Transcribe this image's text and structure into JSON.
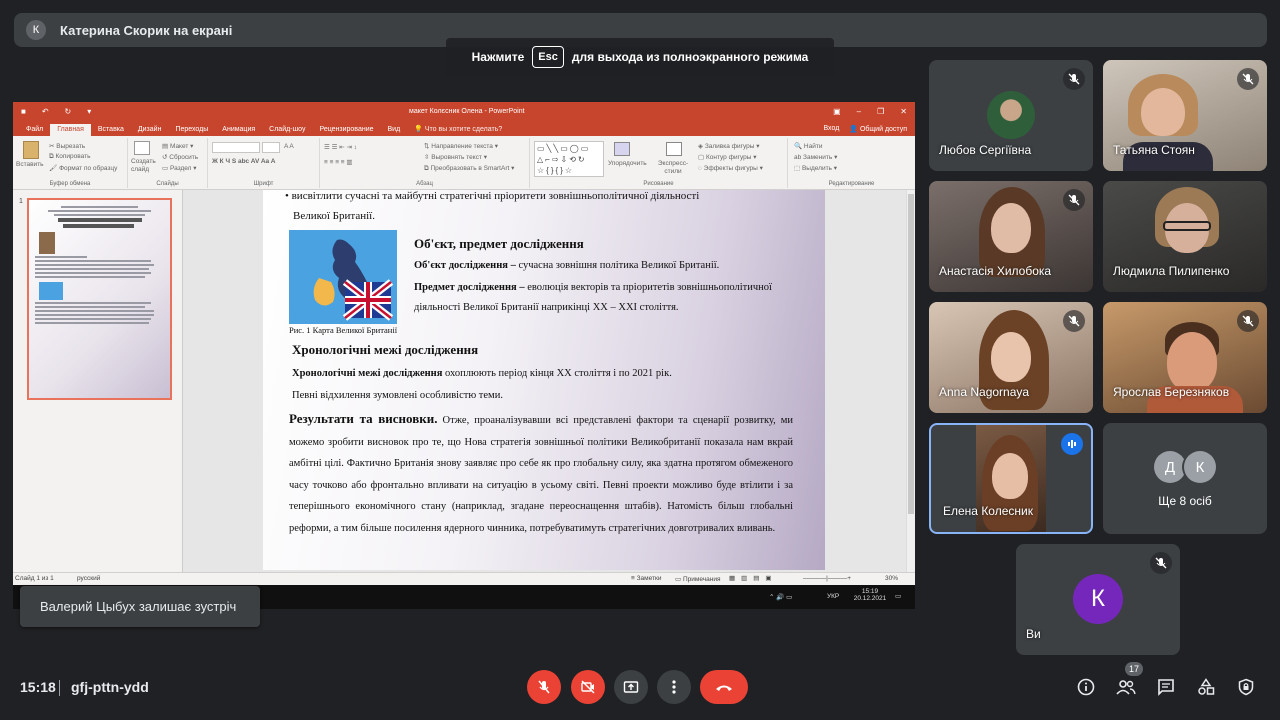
{
  "presenter_bar": {
    "avatar_letter": "К",
    "label": "Катерина Скорик на екрані"
  },
  "esc_hint": {
    "before": "Нажмите",
    "key": "Esc",
    "after": "для выхода из полноэкранного режима"
  },
  "ppt": {
    "window_title": "макет Колєсник Олена - PowerPoint",
    "tabs": [
      "Файл",
      "Главная",
      "Вставка",
      "Дизайн",
      "Переходы",
      "Анимация",
      "Слайд-шоу",
      "Рецензирование",
      "Вид"
    ],
    "active_tab": "Главная",
    "search": "Что вы хотите сделать?",
    "login": "Вход",
    "share": "Общий доступ",
    "ribbon": {
      "paste": "Вставить",
      "cut": "Вырезать",
      "copy": "Копировать",
      "format_painter": "Формат по образцу",
      "clipboard_group": "Буфер обмена",
      "new_slide": "Создать слайд",
      "layout": "Макет",
      "reset": "Сбросить",
      "section": "Раздел",
      "slides_group": "Слайды",
      "font_group": "Шрифт",
      "text_direction": "Направление текста",
      "align_text": "Выровнять текст",
      "smartart": "Преобразовать в SmartArt",
      "paragraph_group": "Абзац",
      "arrange": "Упорядочить",
      "quick_styles": "Экспресс-стили",
      "shape_fill": "Заливка фигуры",
      "shape_outline": "Контур фигуры",
      "shape_effects": "Эффекты фигуры",
      "drawing_group": "Рисование",
      "find": "Найти",
      "replace": "Заменить",
      "select": "Выделить",
      "editing_group": "Редактирование"
    },
    "slide_number": "1",
    "slide": {
      "bullet_line1": "висвітлити сучасні та майбутні стратегічні пріоритети зовнішньополітичної діяльності",
      "bullet_line2": "Великої Британії.",
      "map_caption": "Рис. 1 Карта Великої Британії",
      "object_heading": "Об'єкт, предмет дослідження",
      "object_label": "Об'єкт дослідження –",
      "object_text": "сучасна зовнішня політика Великої Британії.",
      "subject_label": "Предмет дослідження –",
      "subject_text1": "еволюція векторів та пріоритетів зовнішньополітичної",
      "subject_text2": "діяльності Великої Британії наприкінці ХХ – ХХІ століття.",
      "chrono_heading": "Хронологічні межі дослідження",
      "chrono_label": "Хронологічні межі дослідження",
      "chrono_text": "охоплюють період кінця ХХ століття і по 2021 рік.",
      "chrono_note": "Певні відхилення зумовлені особливістю теми.",
      "results_heading": "Результати та висновки.",
      "results_text": "Отже, проаналізувавши всі представлені фактори та сценарії розвитку, ми можемо зробити висновок про те, що Нова стратегія зовнішньої політики Великобританії показала нам вкрай амбітні цілі. Фактично Британія знову заявляє про себе як про глобальну силу, яка здатна протягом обмеженого часу точково або фронтально впливати на ситуацію в усьому світі. Певні проекти можливо буде втілити і за теперішнього економічного стану (наприклад, згадане переоснащення штабів). Натомість більш глобальні реформи, а тим більше посилення ядерного чинника, потребуватимуть стратегічних довготривалих вливань."
    },
    "status": {
      "slide_of": "Слайд 1 из 1",
      "language": "русский",
      "notes": "Заметки",
      "comments": "Примечания",
      "zoom": "30%"
    },
    "taskbar": {
      "lang": "УКР",
      "time": "15:19",
      "date": "20.12.2021"
    }
  },
  "toast": "Валерий Цыбух залишає зустріч",
  "participants": [
    {
      "name": "Любов Сергіївна",
      "muted": true
    },
    {
      "name": "Татьяна Стоян",
      "muted": true
    },
    {
      "name": "Анастасія Хилобока",
      "muted": true
    },
    {
      "name": "Людмила Пилипенко",
      "muted": false
    },
    {
      "name": "Anna Nagornaya",
      "muted": true
    },
    {
      "name": "Ярослав Березняков",
      "muted": true
    },
    {
      "name": "Елена Колесник",
      "muted": false,
      "speaking": true
    },
    {
      "name": "Ще 8 осіб",
      "avatars": [
        "Д",
        "К"
      ]
    },
    {
      "name": "Ви",
      "avatar": "К",
      "muted": true
    }
  ],
  "bottom": {
    "time": "15:18",
    "meeting_code": "gfj-pttn-ydd",
    "people_count": "17"
  },
  "colors": {
    "accent_red": "#ea4335",
    "ppt_orange": "#c8452d",
    "speaking_blue": "#8ab4f8"
  }
}
